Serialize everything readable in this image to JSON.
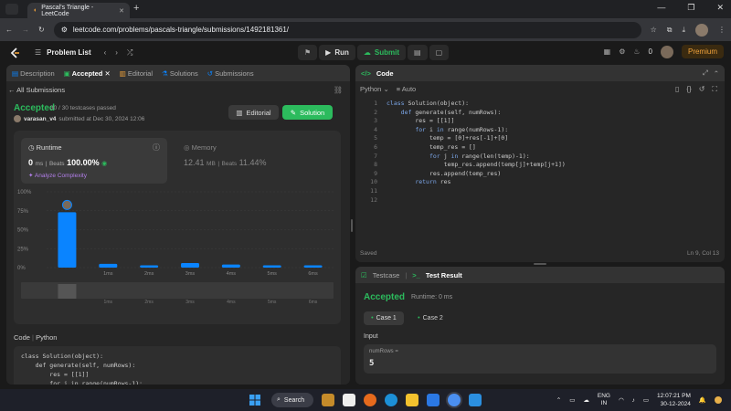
{
  "browser": {
    "tab_title": "Pascal's Triangle - LeetCode",
    "url": "leetcode.com/problems/pascals-triangle/submissions/1492181361/"
  },
  "navbar": {
    "problem_list": "Problem List",
    "run": "Run",
    "submit": "Submit",
    "streak": "0",
    "premium": "Premium"
  },
  "left_tabs": {
    "description": "Description",
    "accepted": "Accepted",
    "editorial": "Editorial",
    "solutions": "Solutions",
    "submissions": "Submissions"
  },
  "submission": {
    "back": "All Submissions",
    "status": "Accepted",
    "testcases": "30 / 30 testcases passed",
    "user": "varasan_v4",
    "submitted": "submitted at Dec 30, 2024 12:06",
    "editorial_btn": "Editorial",
    "solution_btn": "Solution"
  },
  "runtime": {
    "label": "Runtime",
    "value": "0",
    "unit": "ms",
    "beats_label": "Beats",
    "beats": "100.00%",
    "analyze": "Analyze Complexity"
  },
  "memory": {
    "label": "Memory",
    "value": "12.41",
    "unit": "MB",
    "beats_label": "Beats",
    "beats": "11.44%"
  },
  "chart_data": {
    "type": "bar",
    "categories": [
      "0ms",
      "1ms",
      "2ms",
      "3ms",
      "4ms",
      "5ms",
      "6ms"
    ],
    "values": [
      73,
      5,
      3,
      6,
      4,
      3,
      3
    ],
    "ylabel": "",
    "yticks": [
      "100%",
      "75%",
      "50%",
      "25%",
      "0%"
    ],
    "ylim": [
      0,
      100
    ],
    "xlabels_shown": [
      "1ms",
      "2ms",
      "3ms",
      "4ms",
      "5ms",
      "6ms"
    ],
    "grid": true,
    "bar_color": "#0a84ff"
  },
  "code_section": {
    "label": "Code",
    "lang": "Python",
    "lines": [
      "class Solution(object):",
      "    def generate(self, numRows):",
      "        res = [[1]]",
      "        for i in range(numRows-1):",
      "            temp = [0]+res[-1]+[0]"
    ]
  },
  "editor": {
    "title": "Code",
    "lang": "Python",
    "auto": "Auto",
    "saved": "Saved",
    "cursor": "Ln 9, Col 13",
    "lines": [
      "class Solution(object):",
      "    def generate(self, numRows):",
      "        res = [[1]]",
      "        for i in range(numRows-1):",
      "            temp = [0]+res[-1]+[0]",
      "            temp_res = []",
      "            for j in range(len(temp)-1):",
      "                temp_res.append(temp[j]+temp[j+1])",
      "            res.append(temp_res)",
      "        return res",
      "",
      ""
    ],
    "line_numbers": [
      "1",
      "2",
      "3",
      "4",
      "5",
      "6",
      "7",
      "8",
      "9",
      "10",
      "11",
      "12"
    ]
  },
  "testpanel": {
    "testcase_tab": "Testcase",
    "result_tab": "Test Result",
    "status": "Accepted",
    "runtime": "Runtime: 0 ms",
    "case1": "Case 1",
    "case2": "Case 2",
    "input_label": "Input",
    "param": "numRows =",
    "value": "5"
  },
  "taskbar": {
    "search": "Search",
    "lang": "ENG",
    "region": "IN",
    "time": "12:07:21 PM",
    "date": "30-12-2024"
  }
}
